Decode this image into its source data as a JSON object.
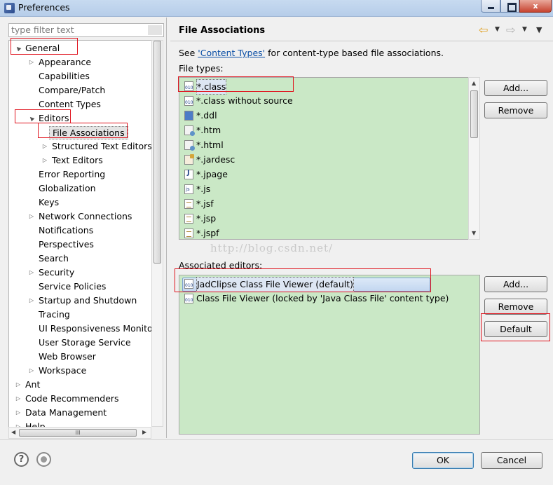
{
  "window": {
    "title": "Preferences",
    "minimize": "",
    "maximize": "",
    "close": "x"
  },
  "filter": {
    "placeholder": "type filter text"
  },
  "tree": [
    {
      "label": "General",
      "level": 0,
      "twisty": "▲"
    },
    {
      "label": "Appearance",
      "level": 1,
      "twisty": "▷"
    },
    {
      "label": "Capabilities",
      "level": 1,
      "twisty": ""
    },
    {
      "label": "Compare/Patch",
      "level": 1,
      "twisty": ""
    },
    {
      "label": "Content Types",
      "level": 1,
      "twisty": ""
    },
    {
      "label": "Editors",
      "level": 1,
      "twisty": "▲"
    },
    {
      "label": "File Associations",
      "level": 2,
      "twisty": "",
      "selected": true
    },
    {
      "label": "Structured Text Editors",
      "level": 2,
      "twisty": "▷"
    },
    {
      "label": "Text Editors",
      "level": 2,
      "twisty": "▷"
    },
    {
      "label": "Error Reporting",
      "level": 1,
      "twisty": ""
    },
    {
      "label": "Globalization",
      "level": 1,
      "twisty": ""
    },
    {
      "label": "Keys",
      "level": 1,
      "twisty": ""
    },
    {
      "label": "Network Connections",
      "level": 1,
      "twisty": "▷"
    },
    {
      "label": "Notifications",
      "level": 1,
      "twisty": ""
    },
    {
      "label": "Perspectives",
      "level": 1,
      "twisty": ""
    },
    {
      "label": "Search",
      "level": 1,
      "twisty": ""
    },
    {
      "label": "Security",
      "level": 1,
      "twisty": "▷"
    },
    {
      "label": "Service Policies",
      "level": 1,
      "twisty": ""
    },
    {
      "label": "Startup and Shutdown",
      "level": 1,
      "twisty": "▷"
    },
    {
      "label": "Tracing",
      "level": 1,
      "twisty": ""
    },
    {
      "label": "UI Responsiveness Monitor",
      "level": 1,
      "twisty": ""
    },
    {
      "label": "User Storage Service",
      "level": 1,
      "twisty": ""
    },
    {
      "label": "Web Browser",
      "level": 1,
      "twisty": ""
    },
    {
      "label": "Workspace",
      "level": 1,
      "twisty": "▷"
    },
    {
      "label": "Ant",
      "level": 0,
      "twisty": "▷"
    },
    {
      "label": "Code Recommenders",
      "level": 0,
      "twisty": "▷"
    },
    {
      "label": "Data Management",
      "level": 0,
      "twisty": "▷"
    },
    {
      "label": "Help",
      "level": 0,
      "twisty": "▷"
    }
  ],
  "page": {
    "title": "File Associations",
    "see_prefix": "See ",
    "see_link": "'Content Types'",
    "see_suffix": " for content-type based file associations.",
    "file_types_label": "File types:",
    "associated_editors_label": "Associated editors:"
  },
  "file_types": [
    {
      "name": "*.class",
      "icon": "bin",
      "selected": true
    },
    {
      "name": "*.class without source",
      "icon": "bin"
    },
    {
      "name": "*.ddl",
      "icon": "ddl"
    },
    {
      "name": "*.htm",
      "icon": "htm"
    },
    {
      "name": "*.html",
      "icon": "htm"
    },
    {
      "name": "*.jardesc",
      "icon": "jar"
    },
    {
      "name": "*.jpage",
      "icon": "jpage"
    },
    {
      "name": "*.js",
      "icon": "js"
    },
    {
      "name": "*.jsf",
      "icon": "txt"
    },
    {
      "name": "*.jsp",
      "icon": "txt"
    },
    {
      "name": "*.jspf",
      "icon": "txt"
    }
  ],
  "associated_editors": [
    {
      "name": "JadClipse Class File Viewer (default)",
      "icon": "bin",
      "selected": true
    },
    {
      "name": "Class File Viewer (locked by 'Java Class File' content type)",
      "icon": "bin"
    }
  ],
  "buttons": {
    "ft_add": "Add...",
    "ft_remove": "Remove",
    "ae_add": "Add...",
    "ae_remove": "Remove",
    "ae_default": "Default",
    "ok": "OK",
    "cancel": "Cancel"
  },
  "nav": {
    "back": "⇦",
    "forward": "⇨",
    "dropdown": "▼",
    "menu": "▼"
  },
  "scroll": {
    "grip": "III",
    "left": "◀",
    "right": "▶",
    "up": "▲",
    "down": "▼"
  },
  "watermark": "http://blog.csdn.net/",
  "icons": {
    "help": "?"
  }
}
